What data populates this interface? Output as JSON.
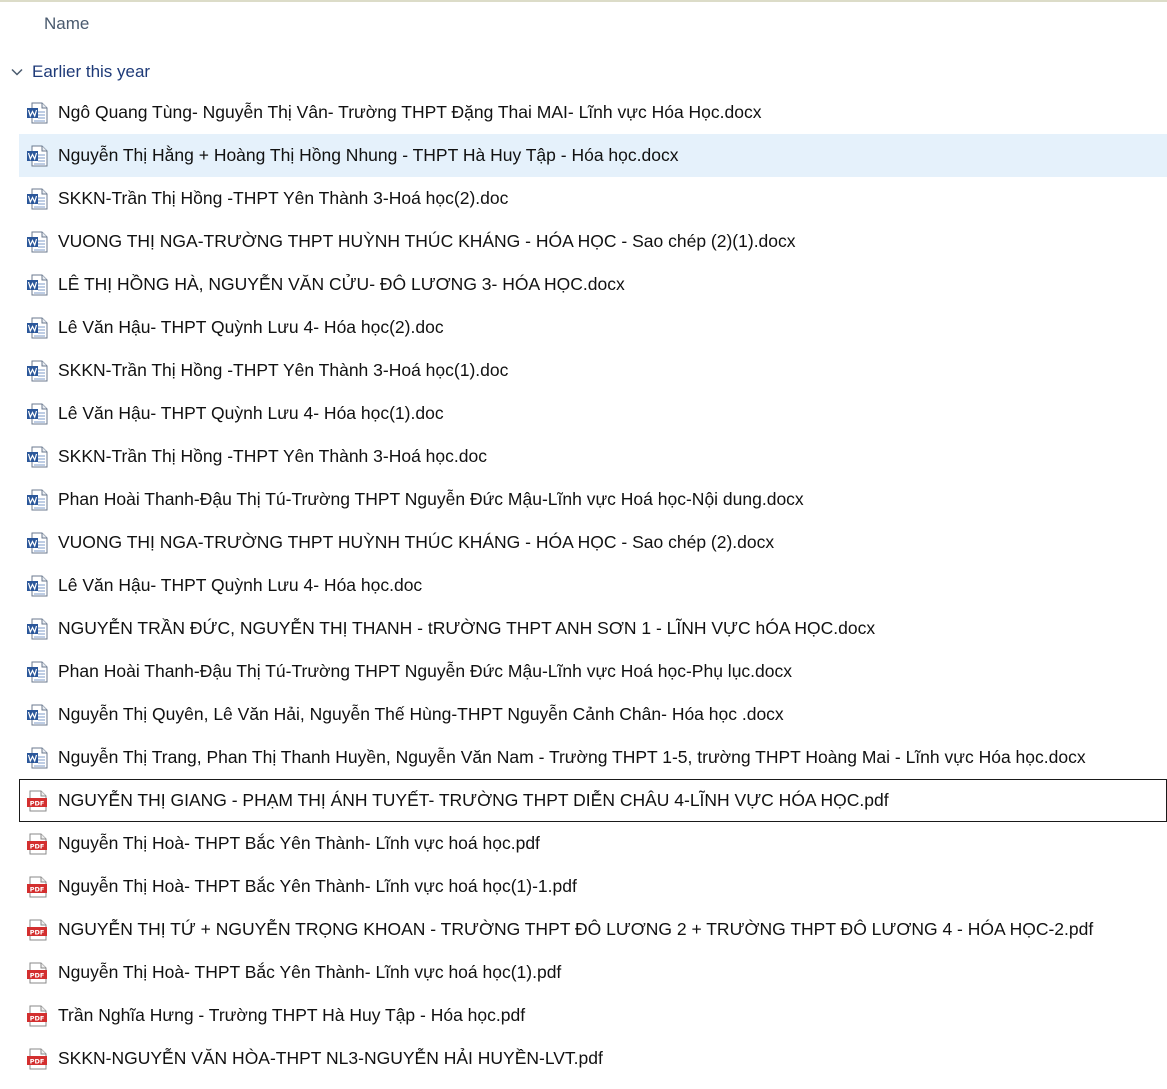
{
  "header": {
    "name_column": "Name"
  },
  "group": {
    "label": "Earlier this year"
  },
  "files": [
    {
      "name": "Ngô Quang Tùng- Nguyễn Thị Vân- Trường THPT Đặng Thai MAI- Lĩnh vực Hóa Học.docx",
      "type": "word"
    },
    {
      "name": "Nguyễn Thị Hằng + Hoàng Thị Hồng Nhung - THPT Hà Huy Tập - Hóa học.docx",
      "type": "word"
    },
    {
      "name": "SKKN-Trần Thị Hồng -THPT Yên Thành 3-Hoá học(2).doc",
      "type": "word"
    },
    {
      "name": "VUONG THỊ NGA-TRƯỜNG THPT HUỲNH THÚC KHÁNG - HÓA HỌC - Sao chép (2)(1).docx",
      "type": "word"
    },
    {
      "name": "LÊ THỊ HỒNG HÀ, NGUYỄN VĂN CỬU- ĐÔ LƯƠNG 3- HÓA HỌC.docx",
      "type": "word"
    },
    {
      "name": "Lê Văn Hậu- THPT Quỳnh Lưu 4- Hóa học(2).doc",
      "type": "word"
    },
    {
      "name": "SKKN-Trần Thị Hồng -THPT Yên Thành 3-Hoá học(1).doc",
      "type": "word"
    },
    {
      "name": "Lê Văn Hậu- THPT Quỳnh Lưu 4- Hóa học(1).doc",
      "type": "word"
    },
    {
      "name": "SKKN-Trần Thị Hồng -THPT Yên Thành 3-Hoá học.doc",
      "type": "word"
    },
    {
      "name": "Phan Hoài Thanh-Đậu Thị Tú-Trường THPT Nguyễn Đức Mậu-Lĩnh vực Hoá học-Nội dung.docx",
      "type": "word"
    },
    {
      "name": "VUONG THỊ NGA-TRƯỜNG THPT HUỲNH THÚC KHÁNG - HÓA HỌC - Sao chép (2).docx",
      "type": "word"
    },
    {
      "name": "Lê Văn Hậu- THPT Quỳnh Lưu 4- Hóa học.doc",
      "type": "word"
    },
    {
      "name": "NGUYỄN TRẦN ĐỨC, NGUYỄN THỊ THANH - tRƯỜNG THPT ANH SƠN 1 - LĨNH VỰC hÓA HỌC.docx",
      "type": "word"
    },
    {
      "name": "Phan Hoài Thanh-Đậu Thị Tú-Trường THPT Nguyễn Đức Mậu-Lĩnh vực Hoá học-Phụ lục.docx",
      "type": "word"
    },
    {
      "name": "Nguyễn Thị Quyên, Lê Văn Hải, Nguyễn Thế Hùng-THPT Nguyễn Cảnh Chân- Hóa học .docx",
      "type": "word"
    },
    {
      "name": "Nguyễn Thị Trang, Phan Thị Thanh Huyền, Nguyễn Văn Nam - Trường THPT 1-5, trường THPT Hoàng Mai - Lĩnh vực Hóa học.docx",
      "type": "word"
    },
    {
      "name": "NGUYỄN THỊ GIANG - PHẠM THỊ ÁNH TUYẾT- TRƯỜNG THPT DIỄN CHÂU 4-LĨNH VỰC HÓA HỌC.pdf",
      "type": "pdf"
    },
    {
      "name": "Nguyễn Thị Hoà- THPT Bắc Yên Thành- Lĩnh vực hoá học.pdf",
      "type": "pdf"
    },
    {
      "name": "Nguyễn Thị Hoà- THPT Bắc Yên Thành- Lĩnh vực hoá học(1)-1.pdf",
      "type": "pdf"
    },
    {
      "name": "NGUYỄN THỊ TỨ + NGUYỄN TRỌNG KHOAN - TRƯỜNG THPT ĐÔ LƯƠNG 2 + TRƯỜNG THPT ĐÔ LƯƠNG 4 - HÓA HỌC-2.pdf",
      "type": "pdf"
    },
    {
      "name": "Nguyễn Thị Hoà- THPT Bắc Yên Thành- Lĩnh vực hoá học(1).pdf",
      "type": "pdf"
    },
    {
      "name": "Trần Nghĩa Hưng - Trường THPT Hà Huy Tập - Hóa học.pdf",
      "type": "pdf"
    },
    {
      "name": "SKKN-NGUYỄN VĂN HÒA-THPT NL3-NGUYỄN HẢI HUYỀN-LVT.pdf",
      "type": "pdf"
    }
  ],
  "selected_index": 1,
  "focused_index": 16,
  "pdf_icon_text": "PDF",
  "colors": {
    "selection": "#e5f1fb",
    "word_blue": "#2b579a",
    "pdf_red": "#d32f2f",
    "group_text": "#1e3a78"
  }
}
